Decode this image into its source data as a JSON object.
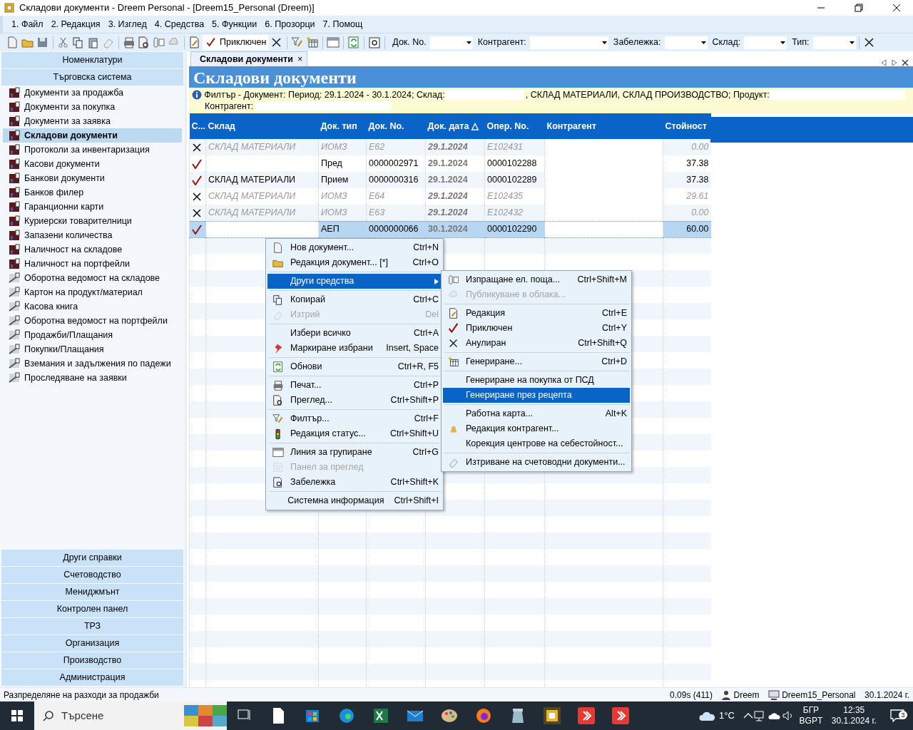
{
  "window": {
    "title": "Складови документи - Dreem Personal - [Dreem15_Personal (Dreem)]"
  },
  "menu": [
    "1. Файл",
    "2. Редакция",
    "3. Изглед",
    "4. Средства",
    "5. Функции",
    "6. Прозорци",
    "7. Помощ"
  ],
  "toolbar": {
    "close_button": "Приключен",
    "filters": [
      {
        "label": "Док. No."
      },
      {
        "label": "Контрагент:"
      },
      {
        "label": "Забележка:"
      },
      {
        "label": "Склад:"
      },
      {
        "label": "Тип:"
      }
    ]
  },
  "sidebar": {
    "top_sections": [
      "Номенклатури",
      "Търговска система"
    ],
    "items": [
      {
        "label": "Документи за продажба",
        "kind": "list",
        "selected": false
      },
      {
        "label": "Документи за покупка",
        "kind": "list",
        "selected": false
      },
      {
        "label": "Документи за заявка",
        "kind": "list",
        "selected": false
      },
      {
        "label": "Складови документи",
        "kind": "list",
        "selected": true
      },
      {
        "label": "Протоколи за инвентаризация",
        "kind": "list",
        "selected": false
      },
      {
        "label": "Касови документи",
        "kind": "list",
        "selected": false
      },
      {
        "label": "Банкови документи",
        "kind": "list",
        "selected": false
      },
      {
        "label": "Банков филер",
        "kind": "list",
        "selected": false
      },
      {
        "label": "Гаранционни карти",
        "kind": "list",
        "selected": false
      },
      {
        "label": "Куриерски товарителници",
        "kind": "list",
        "selected": false
      },
      {
        "label": "Запазени количества",
        "kind": "list",
        "selected": false
      },
      {
        "label": "Наличност на складове",
        "kind": "list",
        "selected": false
      },
      {
        "label": "Наличност на портфейли",
        "kind": "list",
        "selected": false
      },
      {
        "label": "Оборотна ведомост на складове",
        "kind": "report",
        "selected": false
      },
      {
        "label": "Картон на продукт/материал",
        "kind": "report",
        "selected": false
      },
      {
        "label": "Касова книга",
        "kind": "report",
        "selected": false
      },
      {
        "label": "Оборотна ведомост на портфейли",
        "kind": "report",
        "selected": false
      },
      {
        "label": "Продажби/Плащания",
        "kind": "report",
        "selected": false
      },
      {
        "label": "Покупки/Плащания",
        "kind": "report",
        "selected": false
      },
      {
        "label": "Вземания и задължения по падежи",
        "kind": "report",
        "selected": false
      },
      {
        "label": "Проследяване на заявки",
        "kind": "report",
        "selected": false
      }
    ],
    "bottom_sections": [
      "Други справки",
      "Счетоводство",
      "Мениджмънт",
      "Контролен панел",
      "ТРЗ",
      "Организация",
      "Производство",
      "Администрация"
    ]
  },
  "tab": {
    "label": "Складови документи",
    "close": "×"
  },
  "page_title": "Складови документи",
  "filter": {
    "parts": [
      "Филтър - Документ: Период: 29.1.2024 - 30.1.2024; Склад:",
      ", СКЛАД МАТЕРИАЛИ, СКЛАД ПРОИЗВОДСТВО; Продукт:"
    ],
    "second_line": "Контрагент:"
  },
  "table": {
    "columns": [
      "С...",
      "Склад",
      "Док. тип",
      "Док. No.",
      "Док. дата △",
      "Опер. No.",
      "Контрагент",
      "Стойност"
    ],
    "rows": [
      {
        "annulled": true,
        "warehouse": "СКЛАД МАТЕРИАЛИ",
        "doc_type": "ИОМЗ",
        "doc_no": "E62",
        "doc_date": "29.1.2024",
        "oper_no": "E102431",
        "value": "0.00",
        "selected": false
      },
      {
        "annulled": false,
        "doc_type": "Пред",
        "doc_no": "0000002971",
        "doc_date": "29.1.2024",
        "oper_no": "0000102288",
        "value": "37.38",
        "selected": false
      },
      {
        "annulled": false,
        "warehouse": "СКЛАД МАТЕРИАЛИ",
        "doc_type": "Прием",
        "doc_no": "0000000316",
        "doc_date": "29.1.2024",
        "oper_no": "0000102289",
        "value": "37.38",
        "selected": false
      },
      {
        "annulled": true,
        "warehouse": "СКЛАД МАТЕРИАЛИ",
        "doc_type": "ИОМЗ",
        "doc_no": "E64",
        "doc_date": "29.1.2024",
        "oper_no": "E102435",
        "value": "29.61",
        "selected": false
      },
      {
        "annulled": true,
        "warehouse": "СКЛАД МАТЕРИАЛИ",
        "doc_type": "ИОМЗ",
        "doc_no": "E63",
        "doc_date": "29.1.2024",
        "oper_no": "E102432",
        "value": "0.00",
        "selected": false
      },
      {
        "annulled": false,
        "doc_type": "АЕП",
        "doc_no": "0000000066",
        "doc_date": "30.1.2024",
        "oper_no": "0000102290",
        "value": "60.00",
        "selected": true
      }
    ]
  },
  "context_menu": [
    {
      "kind": "item",
      "label": "Нов документ...",
      "shortcut": "Ctrl+N",
      "disabled": false,
      "selected": false,
      "submenu": false
    },
    {
      "kind": "item",
      "label": "Редакция документ... [*]",
      "shortcut": "Ctrl+O",
      "disabled": false,
      "selected": false,
      "submenu": false
    },
    {
      "kind": "separator"
    },
    {
      "kind": "item",
      "label": "Други средства",
      "disabled": false,
      "selected": true,
      "submenu": true
    },
    {
      "kind": "separator"
    },
    {
      "kind": "item",
      "label": "Копирай",
      "shortcut": "Ctrl+C",
      "disabled": false,
      "selected": false,
      "submenu": false
    },
    {
      "kind": "item",
      "label": "Изтрий",
      "shortcut": "Del",
      "disabled": true,
      "selected": false,
      "submenu": false
    },
    {
      "kind": "separator"
    },
    {
      "kind": "item",
      "label": "Избери всичко",
      "shortcut": "Ctrl+A",
      "disabled": false,
      "selected": false,
      "submenu": false
    },
    {
      "kind": "item",
      "label": "Маркиране избрани",
      "shortcut": "Insert, Space",
      "disabled": false,
      "selected": false,
      "submenu": false
    },
    {
      "kind": "separator"
    },
    {
      "kind": "item",
      "label": "Обнови",
      "shortcut": "Ctrl+R, F5",
      "disabled": false,
      "selected": false,
      "submenu": false
    },
    {
      "kind": "separator"
    },
    {
      "kind": "item",
      "label": "Печат...",
      "shortcut": "Ctrl+P",
      "disabled": false,
      "selected": false,
      "submenu": false
    },
    {
      "kind": "item",
      "label": "Преглед...",
      "shortcut": "Ctrl+Shift+P",
      "disabled": false,
      "selected": false,
      "submenu": false
    },
    {
      "kind": "separator"
    },
    {
      "kind": "item",
      "label": "Филтър...",
      "shortcut": "Ctrl+F",
      "disabled": false,
      "selected": false,
      "submenu": false
    },
    {
      "kind": "item",
      "label": "Редакция статус...",
      "shortcut": "Ctrl+Shift+U",
      "disabled": false,
      "selected": false,
      "submenu": false
    },
    {
      "kind": "separator"
    },
    {
      "kind": "item",
      "label": "Линия за групиране",
      "shortcut": "Ctrl+G",
      "disabled": false,
      "selected": false,
      "submenu": false
    },
    {
      "kind": "item",
      "label": "Панел за преглед",
      "disabled": true,
      "selected": false,
      "submenu": false
    },
    {
      "kind": "item",
      "label": "Забележка",
      "shortcut": "Ctrl+Shift+K",
      "disabled": false,
      "selected": false,
      "submenu": false
    },
    {
      "kind": "separator"
    },
    {
      "kind": "item",
      "label": "Системна информация",
      "shortcut": "Ctrl+Shift+I",
      "disabled": false,
      "selected": false,
      "submenu": false
    }
  ],
  "submenu": [
    {
      "kind": "item",
      "label": "Изпращане ел. поща...",
      "shortcut": "Ctrl+Shift+M",
      "disabled": false,
      "selected": false
    },
    {
      "kind": "item",
      "label": "Публикуване в облака...",
      "disabled": true,
      "selected": false
    },
    {
      "kind": "separator"
    },
    {
      "kind": "item",
      "label": "Редакция",
      "shortcut": "Ctrl+E",
      "disabled": false,
      "selected": false
    },
    {
      "kind": "item",
      "label": "Приключен",
      "shortcut": "Ctrl+Y",
      "disabled": false,
      "selected": false
    },
    {
      "kind": "item",
      "label": "Анулиран",
      "shortcut": "Ctrl+Shift+Q",
      "disabled": false,
      "selected": false
    },
    {
      "kind": "separator"
    },
    {
      "kind": "item",
      "label": "Генериране...",
      "shortcut": "Ctrl+D",
      "disabled": false,
      "selected": false
    },
    {
      "kind": "separator"
    },
    {
      "kind": "item",
      "label": "Генериране на покупка от ПСД",
      "disabled": false,
      "selected": false
    },
    {
      "kind": "item",
      "label": "Генериране през рецепта",
      "disabled": false,
      "selected": true
    },
    {
      "kind": "separator"
    },
    {
      "kind": "item",
      "label": "Работна карта...",
      "shortcut": "Alt+K",
      "disabled": false,
      "selected": false
    },
    {
      "kind": "item",
      "label": "Редакция контрагент...",
      "disabled": false,
      "selected": false
    },
    {
      "kind": "item",
      "label": "Корекция центрове на себестойност...",
      "disabled": false,
      "selected": false
    },
    {
      "kind": "separator"
    },
    {
      "kind": "item",
      "label": "Изтриване на счетоводни документи...",
      "disabled": false,
      "selected": false
    }
  ],
  "status_bar": {
    "message": "Разпределяне на разходи за продажби",
    "timing": "0.09s (411)",
    "user": "Dreem",
    "database": "Dreem15_Personal",
    "date": "30.1.2024 г."
  },
  "taskbar": {
    "search": "Търсене",
    "weather": "1°C",
    "language": "БГР",
    "layout": "BGPT",
    "time": "12:35",
    "date": "30.1.2024 г.",
    "notifications": "3"
  }
}
